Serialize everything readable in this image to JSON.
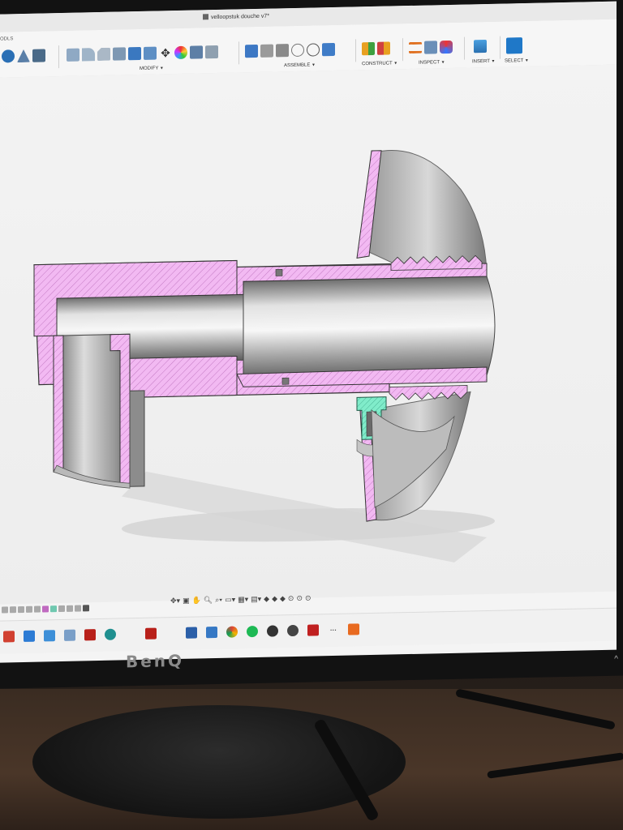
{
  "window": {
    "document_title": "velloopstuk douche v7*"
  },
  "toolbar": {
    "tools_label": "ODLS",
    "groups": [
      {
        "label": "MODIFY"
      },
      {
        "label": "ASSEMBLE"
      },
      {
        "label": "CONSTRUCT"
      },
      {
        "label": "INSPECT"
      },
      {
        "label": "INSERT"
      },
      {
        "label": "SELECT"
      }
    ]
  },
  "monitor": {
    "brand": "BenQ"
  },
  "colors": {
    "section_fill": "#f0b8f0",
    "section_hatch": "#b060b0",
    "insert_fill": "#7de8c8",
    "metal_light": "#e8e8e8",
    "metal_dark": "#7a7a7a",
    "select_accent": "#1f78c8"
  },
  "icons": {
    "navbar": [
      "orbit-icon",
      "pan-icon",
      "zoom-icon",
      "fit-icon",
      "display-settings-icon",
      "grid-icon",
      "viewports-icon",
      "visual-style-icon"
    ],
    "taskbar": [
      "powerpoint-icon",
      "onedrive-icon",
      "mail-icon",
      "image-icon",
      "filezilla-icon",
      "arduino-icon",
      "app-l-icon",
      "filezilla2-icon",
      "blender-icon",
      "notepad-icon",
      "fusion-icon",
      "chrome-icon",
      "spotify-icon",
      "media-icon",
      "media2-icon",
      "red-app-icon",
      "dots-icon",
      "orange-app-icon"
    ]
  }
}
